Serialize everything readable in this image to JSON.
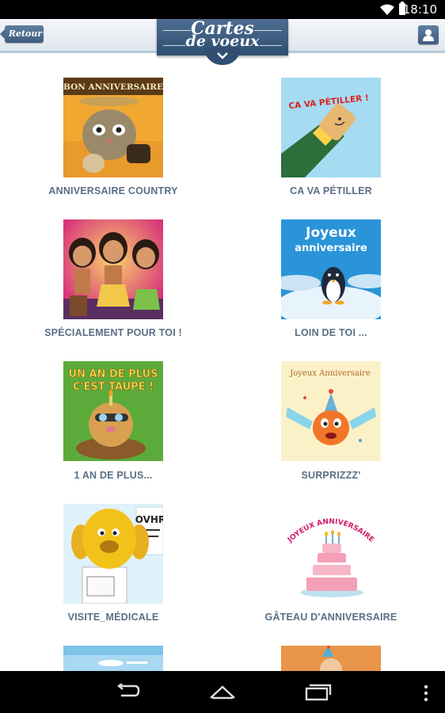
{
  "status_bar": {
    "time": "18:10"
  },
  "header": {
    "back_label": "Retour",
    "logo_line1": "Cartes",
    "logo_line2": "de voeux"
  },
  "cards": [
    {
      "label": "ANNIVERSAIRE COUNTRY",
      "banner": "BON ANNIVERSAIRE"
    },
    {
      "label": "CA VA PÉTILLER",
      "banner": "CA VA PÉTILLER !"
    },
    {
      "label": "SPÉCIALEMENT POUR TOI !"
    },
    {
      "label": "LOIN DE TOI ...",
      "banner_line1": "Joyeux",
      "banner_line2": "anniversaire"
    },
    {
      "label": "1 AN DE PLUS...",
      "banner_line1": "UN AN DE PLUS",
      "banner_line2": "C'EST TAUPE !"
    },
    {
      "label": "SURPRIZZZ'",
      "banner": "Joyeux Anniversaire"
    },
    {
      "label": "VISITE_MÉDICALE",
      "chart_text": "OVHR"
    },
    {
      "label": "GÂTEAU D'ANNIVERSAIRE",
      "banner": "JOYEUX ANNIVERSAIRE"
    }
  ],
  "colors": {
    "header_blue": "#3e5d80",
    "label_color": "#5a6f86"
  }
}
